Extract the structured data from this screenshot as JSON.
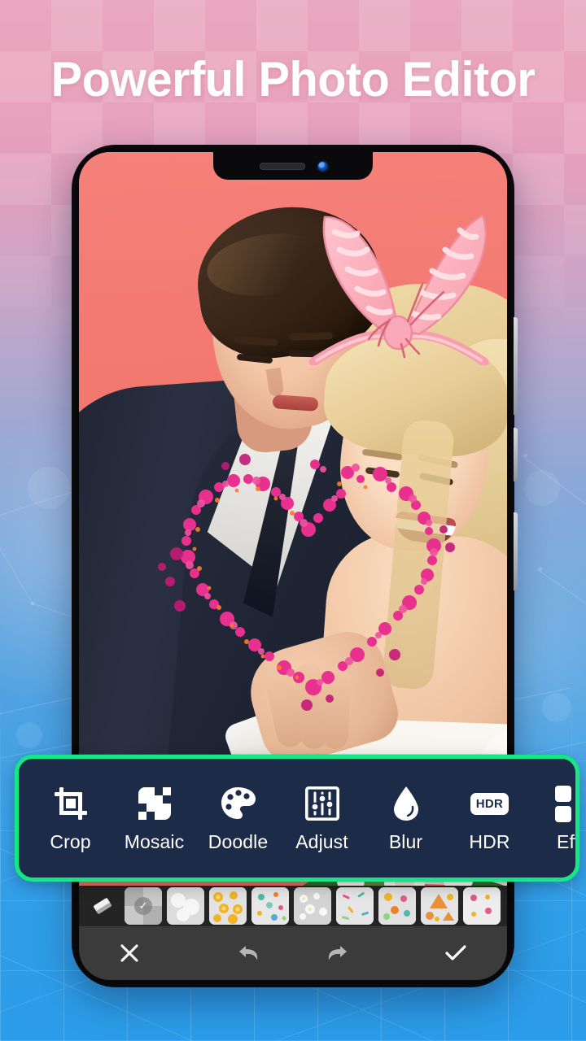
{
  "headline": "Powerful Photo Editor",
  "theme": {
    "highlight_green": "#15e787",
    "toolbar_navy": "#1c2b48",
    "photo_backdrop": "#f0756d",
    "bg_top_pink": "#e8a8bf",
    "bg_bottom_blue": "#2b9ce9",
    "doodle_pink": "#e8318f"
  },
  "phone": {
    "notch": {
      "speaker": "speaker-grille",
      "camera": "front-camera"
    },
    "side_buttons": [
      "volume-up",
      "volume-down",
      "power"
    ]
  },
  "editor": {
    "canvas": {
      "stickers": [
        {
          "name": "bunny-ears",
          "label": "Bunny Ears Sticker"
        }
      ],
      "doodles": [
        {
          "name": "heart-dots",
          "label": "Heart Doodle"
        }
      ]
    },
    "toolbar": {
      "items": [
        {
          "id": "crop",
          "label": "Crop",
          "icon": "crop-icon"
        },
        {
          "id": "mosaic",
          "label": "Mosaic",
          "icon": "mosaic-icon"
        },
        {
          "id": "doodle",
          "label": "Doodle",
          "icon": "palette-icon"
        },
        {
          "id": "adjust",
          "label": "Adjust",
          "icon": "sliders-icon"
        },
        {
          "id": "blur",
          "label": "Blur",
          "icon": "droplet-icon"
        },
        {
          "id": "hdr",
          "label": "HDR",
          "icon": "hdr-icon",
          "badge": "HDR"
        },
        {
          "id": "effects",
          "label": "Effe",
          "icon": "grid-icon"
        }
      ]
    },
    "sticker_strip": {
      "eraser": "eraser-icon",
      "thumbnails": [
        {
          "id": "t1",
          "selected": true,
          "check": "✓"
        },
        {
          "id": "t2",
          "selected": false
        },
        {
          "id": "t3",
          "selected": false
        },
        {
          "id": "t4",
          "selected": false
        },
        {
          "id": "t5",
          "selected": false
        },
        {
          "id": "t6",
          "selected": false
        },
        {
          "id": "t7",
          "selected": false
        },
        {
          "id": "t8",
          "selected": false
        },
        {
          "id": "t9",
          "selected": false
        }
      ]
    },
    "action_bar": {
      "cancel": "close-icon",
      "undo": "undo-icon",
      "redo": "redo-icon",
      "confirm": "check-icon"
    }
  }
}
